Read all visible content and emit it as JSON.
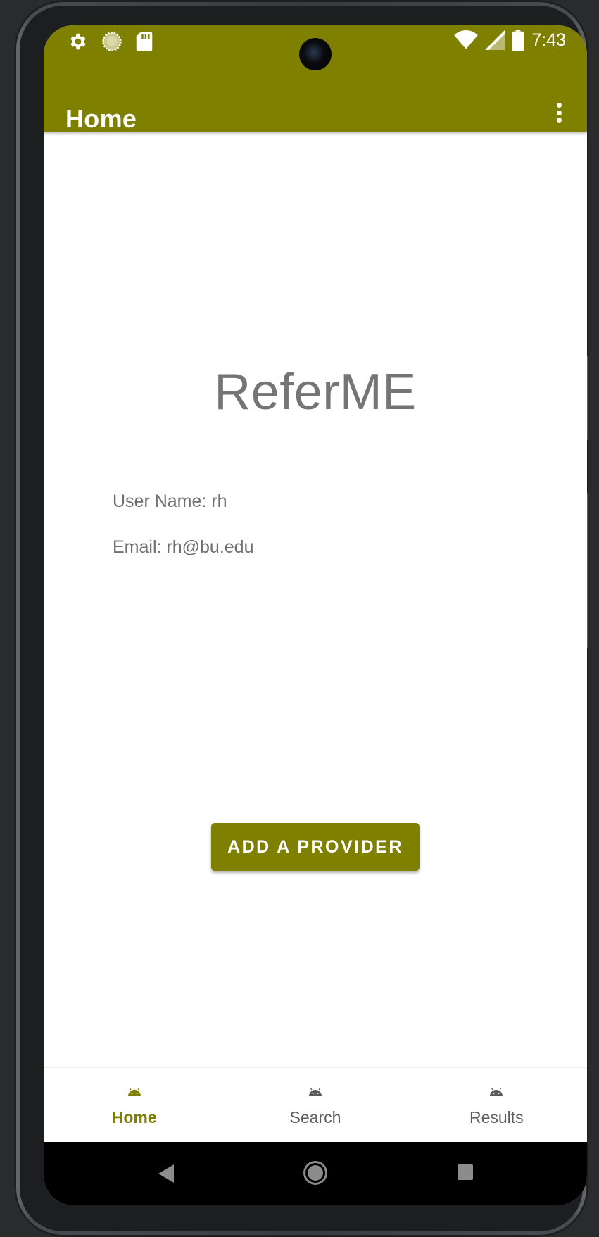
{
  "status_bar": {
    "time": "7:43",
    "left_icons": [
      "gear-icon",
      "loading-circle-icon",
      "sd-card-icon"
    ],
    "right_icons": [
      "wifi-icon",
      "signal-icon",
      "battery-icon"
    ]
  },
  "app_bar": {
    "title": "Home",
    "menu_icon": "more-vert-icon",
    "color": "#808000"
  },
  "main": {
    "brand_title": "ReferME",
    "user_name": "User Name: rh",
    "email": "Email: rh@bu.edu",
    "add_provider_label": "ADD A PROVIDER"
  },
  "bottom_nav": {
    "items": [
      {
        "label": "Home",
        "icon": "android-icon",
        "active": true
      },
      {
        "label": "Search",
        "icon": "android-icon",
        "active": false
      },
      {
        "label": "Results",
        "icon": "android-icon",
        "active": false
      }
    ]
  },
  "system_nav": {
    "buttons": [
      "back-icon",
      "home-circle-icon",
      "recents-square-icon"
    ]
  },
  "colors": {
    "accent": "#808000",
    "text_gray": "#757575",
    "nav_inactive": "#5d5d5d"
  }
}
